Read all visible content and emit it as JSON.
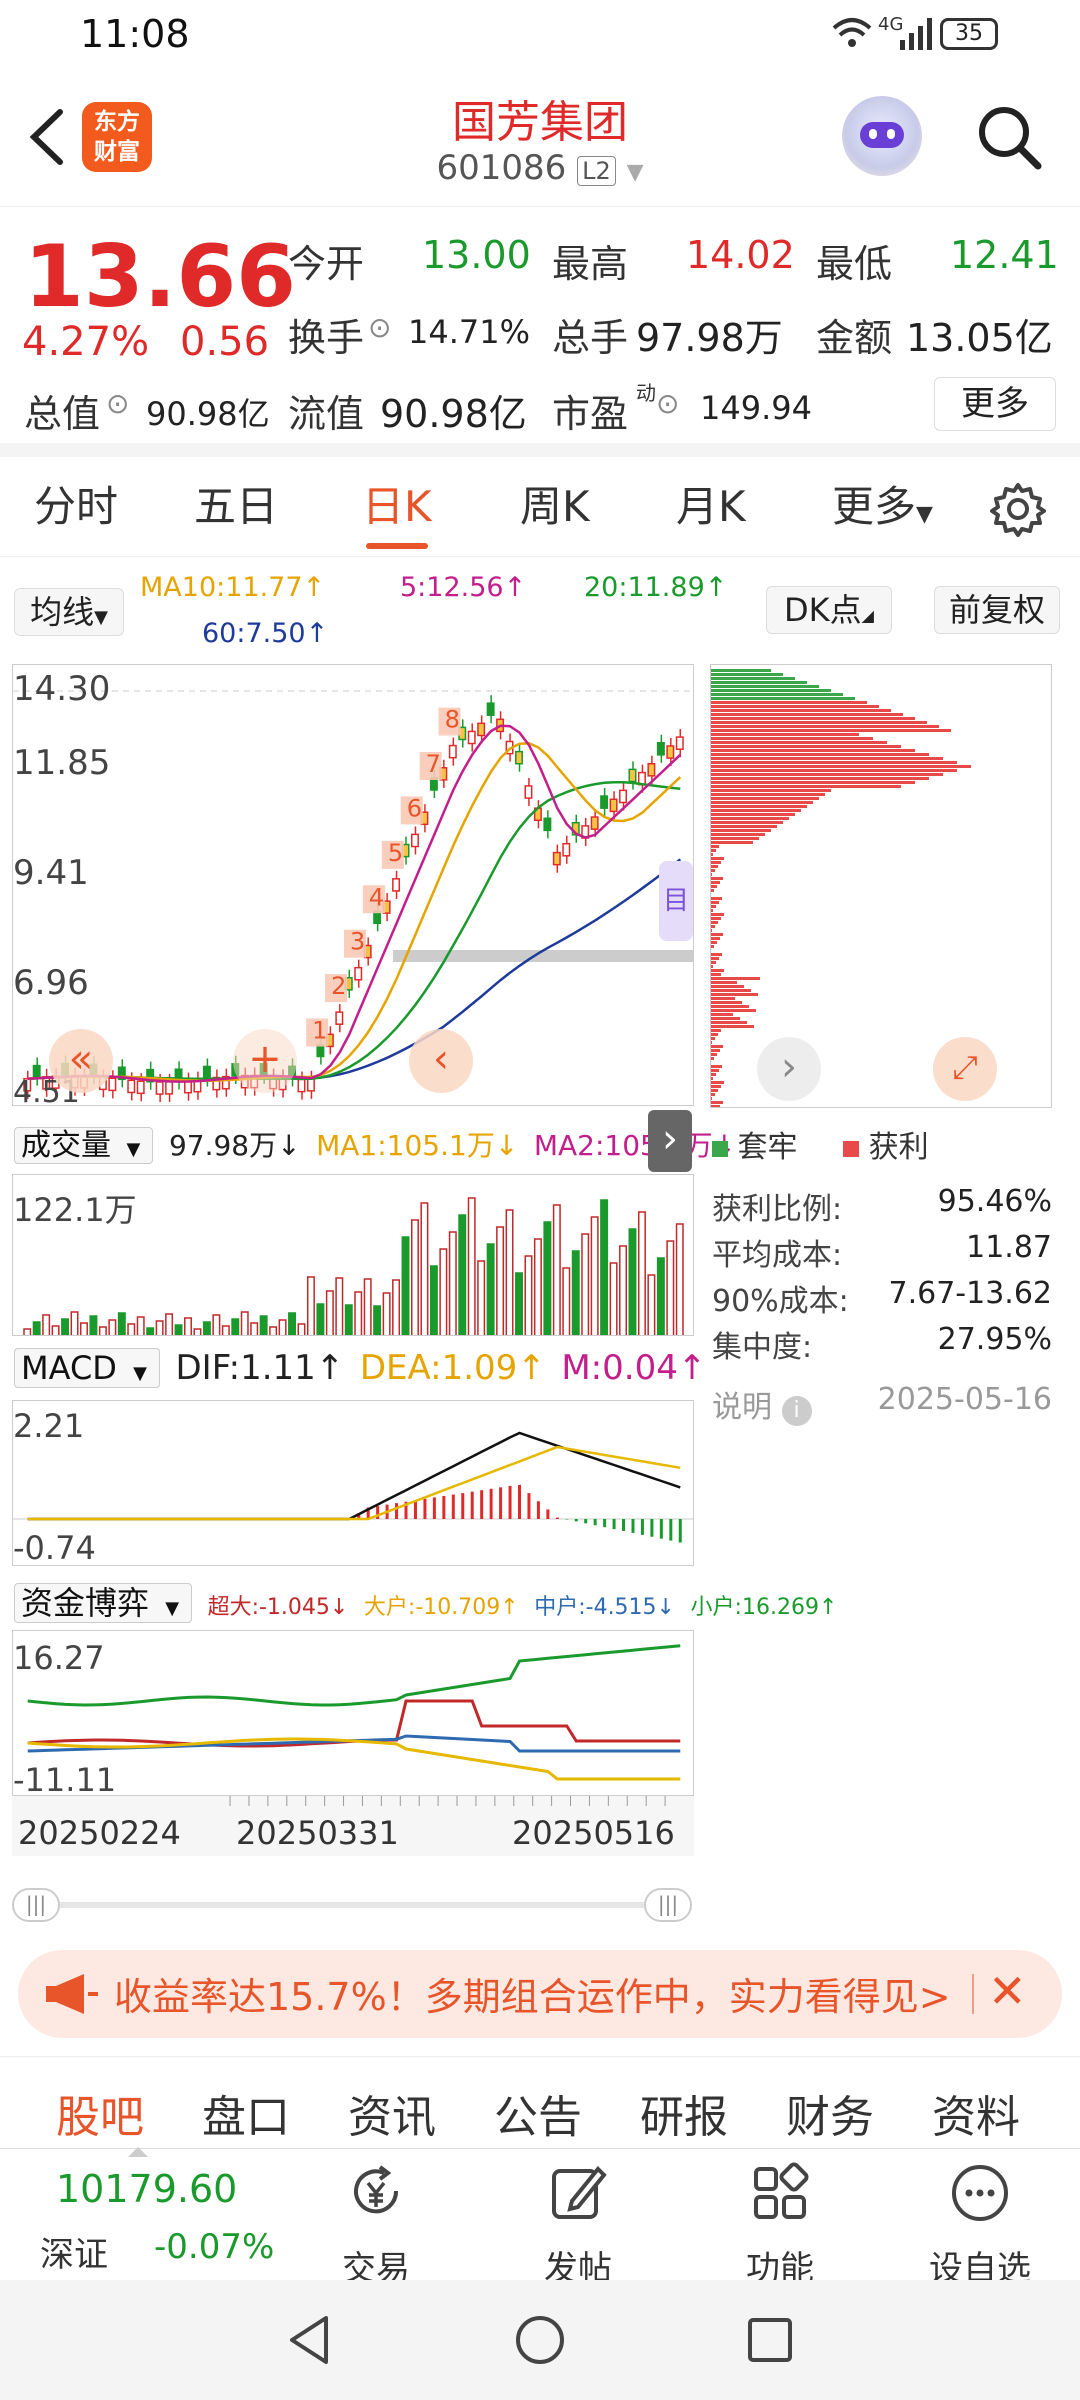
{
  "status": {
    "time": "11:08",
    "battery": "35",
    "network": "4G"
  },
  "header": {
    "back_icon": "chevron-left-icon",
    "logo_line1": "东方",
    "logo_line2": "财富",
    "title": "国芳集团",
    "code": "601086",
    "level": "L2",
    "search_icon": "search-icon"
  },
  "quote": {
    "price": "13.66",
    "change_pct": "4.27%",
    "change": "0.56",
    "open_label": "今开",
    "open": "13.00",
    "high_label": "最高",
    "high": "14.02",
    "low_label": "最低",
    "low": "12.41",
    "turnover_label": "换手",
    "turnover": "14.71%",
    "volume_label": "总手",
    "volume": "97.98万",
    "amount_label": "金额",
    "amount": "13.05亿",
    "mcap_label": "总值",
    "mcap": "90.98亿",
    "float_label": "流值",
    "float": "90.98亿",
    "pe_label": "市盈",
    "pe_sup": "动",
    "pe": "149.94",
    "more": "更多"
  },
  "tabs": [
    "分时",
    "五日",
    "日K",
    "周K",
    "月K",
    "更多"
  ],
  "active_tab": 2,
  "kline": {
    "ma_select": "均线",
    "ma10": "MA10:11.77↑",
    "ma5": "5:12.56↑",
    "ma20": "20:11.89↑",
    "ma60": "60:7.50↑",
    "dk": "DK点",
    "adjust": "前复权",
    "y_labels": [
      "14.30",
      "11.85",
      "9.41",
      "6.96",
      "4.51"
    ],
    "colors": {
      "up": "#e02a2a",
      "down": "#1a9a2c",
      "ma5": "#c21e8c",
      "ma10": "#e6a400",
      "ma20": "#1a9a2c",
      "ma60": "#1e3a9a"
    }
  },
  "volume": {
    "select": "成交量",
    "vol": "97.98万↓",
    "ma1": "MA1:105.1万↓",
    "ma2": "MA2:105.1万↓",
    "y_label": "122.1万"
  },
  "macd": {
    "select": "MACD",
    "dif": "DIF:1.11↑",
    "dea": "DEA:1.09↑",
    "m": "M:0.04↑",
    "y_top": "2.21",
    "y_bottom": "-0.74"
  },
  "fund": {
    "select": "资金博弈",
    "super": "超大:-1.045↓",
    "large": "大户:-10.709↑",
    "mid": "中户:-4.515↓",
    "small": "小户:16.269↑",
    "y_top": "16.27",
    "y_bottom": "-11.11"
  },
  "dates": [
    "20250224",
    "20250331",
    "20250516"
  ],
  "chips": {
    "legend_trapped": "套牢",
    "legend_profit": "获利",
    "rows": [
      {
        "label": "获利比例:",
        "value": "95.46%"
      },
      {
        "label": "平均成本:",
        "value": "11.87"
      },
      {
        "label": "90%成本:",
        "value": "7.67-13.62"
      },
      {
        "label": "集中度:",
        "value": "27.95%"
      }
    ],
    "note": "说明",
    "date": "2025-05-16"
  },
  "banner": {
    "text": "收益率达15.7%！多期组合运作中，实力看得见>"
  },
  "subtabs": [
    "股吧",
    "盘口",
    "资讯",
    "公告",
    "研报",
    "财务",
    "资料"
  ],
  "bottom": {
    "index_value": "10179.60",
    "index_name": "深证",
    "index_change": "-0.07%",
    "items": [
      {
        "label": "交易",
        "icon": "yen-icon"
      },
      {
        "label": "发帖",
        "icon": "edit-icon"
      },
      {
        "label": "功能",
        "icon": "grid-icon"
      },
      {
        "label": "设自选",
        "icon": "more-icon"
      }
    ]
  }
}
